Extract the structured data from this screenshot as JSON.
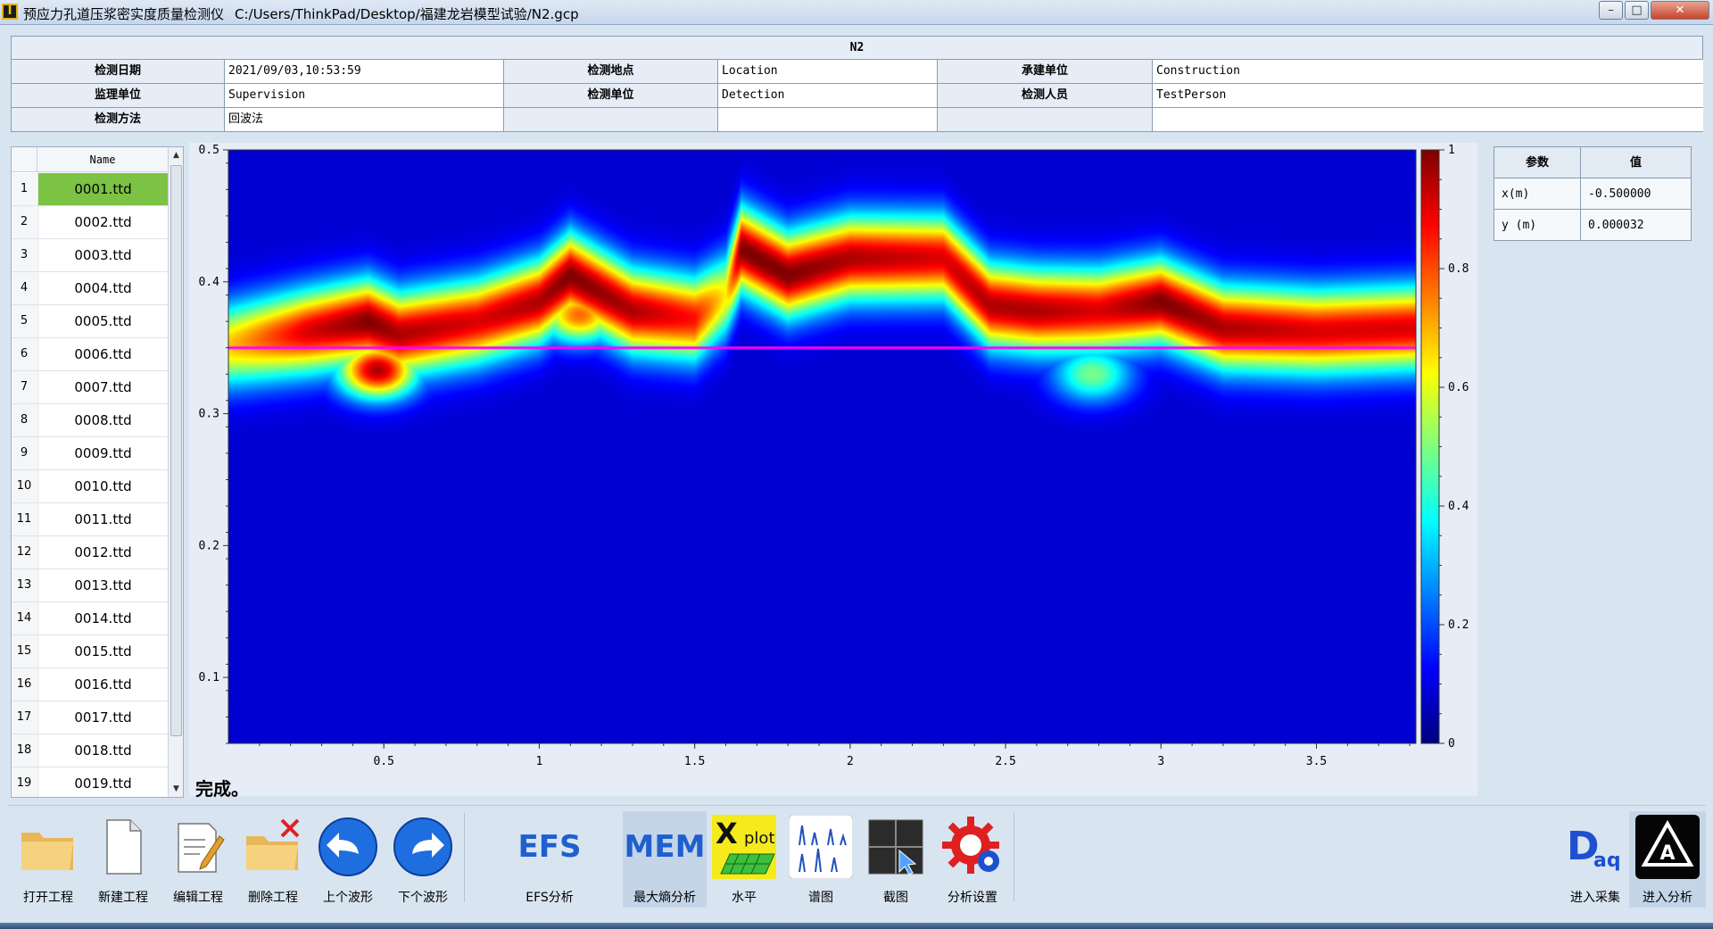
{
  "window": {
    "app_title": "预应力孔道压浆密实度质量检测仪",
    "file_path": "C:/Users/ThinkPad/Desktop/福建龙岩模型试验/N2.gcp",
    "icon_letter": "I"
  },
  "info": {
    "title": "N2",
    "rows": [
      [
        {
          "label": "检测日期",
          "value": "2021/09/03,10:53:59"
        },
        {
          "label": "检测地点",
          "value": "Location"
        },
        {
          "label": "承建单位",
          "value": "Construction"
        }
      ],
      [
        {
          "label": "监理单位",
          "value": "Supervision"
        },
        {
          "label": "检测单位",
          "value": "Detection"
        },
        {
          "label": "检测人员",
          "value": "TestPerson"
        }
      ],
      [
        {
          "label": "检测方法",
          "value": "回波法"
        },
        {
          "label": "",
          "value": ""
        },
        {
          "label": "",
          "value": ""
        }
      ]
    ]
  },
  "file_list": {
    "header": "Name",
    "selected_index": 0,
    "items": [
      {
        "num": "1",
        "name": "0001.ttd"
      },
      {
        "num": "2",
        "name": "0002.ttd"
      },
      {
        "num": "3",
        "name": "0003.ttd"
      },
      {
        "num": "4",
        "name": "0004.ttd"
      },
      {
        "num": "5",
        "name": "0005.ttd"
      },
      {
        "num": "6",
        "name": "0006.ttd"
      },
      {
        "num": "7",
        "name": "0007.ttd"
      },
      {
        "num": "8",
        "name": "0008.ttd"
      },
      {
        "num": "9",
        "name": "0009.ttd"
      },
      {
        "num": "10",
        "name": "0010.ttd"
      },
      {
        "num": "11",
        "name": "0011.ttd"
      },
      {
        "num": "12",
        "name": "0012.ttd"
      },
      {
        "num": "13",
        "name": "0013.ttd"
      },
      {
        "num": "14",
        "name": "0014.ttd"
      },
      {
        "num": "15",
        "name": "0015.ttd"
      },
      {
        "num": "16",
        "name": "0016.ttd"
      },
      {
        "num": "17",
        "name": "0017.ttd"
      },
      {
        "num": "18",
        "name": "0018.ttd"
      },
      {
        "num": "19",
        "name": "0019.ttd"
      }
    ]
  },
  "status": "完成。",
  "params": {
    "headers": [
      "参数",
      "值"
    ],
    "rows": [
      {
        "name": "x(m)",
        "value": "-0.500000"
      },
      {
        "name": "y (m)",
        "value": "0.000032"
      }
    ]
  },
  "toolbar": {
    "items": [
      {
        "id": "open",
        "label": "打开工程",
        "icon": "folder-icon"
      },
      {
        "id": "new",
        "label": "新建工程",
        "icon": "new-document-icon"
      },
      {
        "id": "edit",
        "label": "编辑工程",
        "icon": "edit-document-icon"
      },
      {
        "id": "delete",
        "label": "删除工程",
        "icon": "delete-folder-icon"
      },
      {
        "id": "prev",
        "label": "上个波形",
        "icon": "arrow-left-icon"
      },
      {
        "id": "next",
        "label": "下个波形",
        "icon": "arrow-right-icon"
      },
      {
        "id": "efs",
        "label": "EFS分析",
        "icon": "efs-icon",
        "icon_text": "EFS"
      },
      {
        "id": "mem",
        "label": "最大熵分析",
        "icon": "mem-icon",
        "icon_text": "MEM",
        "active": true
      },
      {
        "id": "level",
        "label": "水平",
        "icon": "xplot-icon",
        "icon_text_big": "X",
        "icon_text_small": "plot"
      },
      {
        "id": "spectrum",
        "label": "谱图",
        "icon": "spectrum-icon"
      },
      {
        "id": "capture",
        "label": "截图",
        "icon": "screenshot-icon"
      },
      {
        "id": "settings",
        "label": "分析设置",
        "icon": "settings-gear-icon"
      },
      {
        "id": "acquire",
        "label": "进入采集",
        "icon": "daq-icon",
        "icon_text_big": "D",
        "icon_text_small": "aq"
      },
      {
        "id": "analyze",
        "label": "进入分析",
        "icon": "analyze-icon",
        "icon_text": "A",
        "active": true
      }
    ]
  },
  "colors": {
    "selected_row": "#7cc244",
    "marker_line": "#ff00ff",
    "efs_text": "#1f5fcf",
    "mem_text": "#1f5fcf"
  },
  "chart_data": {
    "type": "heatmap",
    "colormap": "jet",
    "xlim": [
      0.0,
      3.82
    ],
    "ylim": [
      0.05,
      0.5
    ],
    "x_ticks": [
      "0.5",
      "1",
      "1.5",
      "2",
      "2.5",
      "3",
      "3.5"
    ],
    "y_ticks": [
      "0.1",
      "0.2",
      "0.3",
      "0.4",
      "0.5"
    ],
    "colorbar": {
      "range": [
        0,
        1
      ],
      "ticks": [
        "0",
        "0.2",
        "0.4",
        "0.6",
        "0.8",
        "1"
      ]
    },
    "marker_y": 0.35,
    "ridge": {
      "x": [
        0.0,
        0.25,
        0.45,
        0.55,
        0.8,
        1.0,
        1.1,
        1.3,
        1.5,
        1.6,
        1.65,
        1.8,
        2.0,
        2.3,
        2.45,
        2.6,
        2.8,
        3.0,
        3.2,
        3.5,
        3.82
      ],
      "y": [
        0.352,
        0.362,
        0.37,
        0.36,
        0.37,
        0.385,
        0.405,
        0.378,
        0.372,
        0.39,
        0.425,
        0.405,
        0.418,
        0.418,
        0.382,
        0.378,
        0.378,
        0.385,
        0.365,
        0.362,
        0.365
      ],
      "intensity": [
        0.65,
        0.9,
        1.0,
        0.95,
        0.9,
        0.95,
        1.0,
        0.95,
        0.85,
        0.6,
        1.0,
        1.0,
        0.95,
        0.9,
        0.95,
        0.95,
        0.9,
        1.0,
        0.95,
        0.9,
        0.9
      ]
    },
    "blobs": [
      {
        "x": 0.48,
        "y": 0.333,
        "value": 0.95
      },
      {
        "x": 2.78,
        "y": 0.33,
        "value": 0.45
      },
      {
        "x": 1.13,
        "y": 0.375,
        "value": 0.75
      }
    ]
  }
}
